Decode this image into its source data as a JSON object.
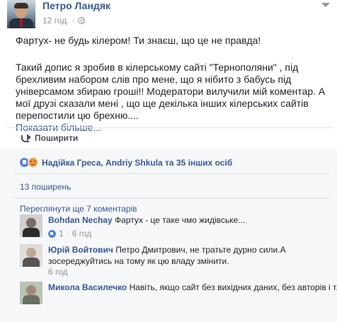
{
  "post": {
    "author": "Петро Ландяк",
    "timestamp": "12 год.",
    "text_line1": "Фартух- не будь кілером! Ти знаєш, що це не правда!",
    "text_para2": "Такий допис я зробив в кілерському сайті \"Тернополяни\" , під брехливим набором слів про мене, що я нібито з бабусь під універсамом збираю гроші!! Модератори вилучили мій коментар. А мої друзі сказали мені , що ще декілька інших кілерських сайтів перепостили цю брехню....",
    "see_more": "Показати більше...",
    "share_label": "Поширити"
  },
  "reactions": {
    "text": "Надійка Греса, Andriy Shkula та 35 інших осіб"
  },
  "shares": {
    "text": "13 поширень"
  },
  "comments_section": {
    "prev_link": "Переглянути ще 7 коментарів",
    "items": [
      {
        "name": "Bohdan Nechay",
        "text": "Фартух - це таке чмо жидівське...",
        "likes": "1",
        "time": "6 год"
      },
      {
        "name": "Юрій Войтович",
        "text": "Петро Дмитрович, не тратьте дурно сили.А зосереджуйтись на тому як цю владу змінити.",
        "time": "6 год"
      },
      {
        "name": "Микола Василечко",
        "text": "Навіть, якщо сайт без вихідних даних, без авторів і т. п.,"
      }
    ]
  }
}
